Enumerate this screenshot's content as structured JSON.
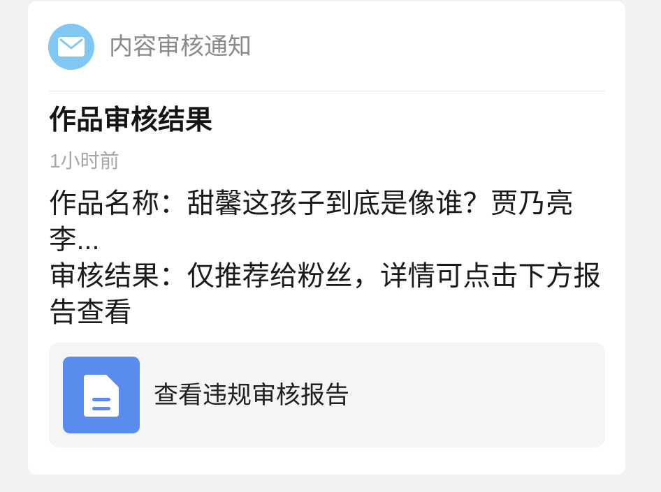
{
  "header": {
    "icon": "envelope-icon",
    "title": "内容审核通知"
  },
  "notification": {
    "title": "作品审核结果",
    "time": "1小时前",
    "work_name_label": "作品名称：",
    "work_name_value": "甜馨这孩子到底是像谁？贾乃亮李...",
    "result_label": "审核结果：",
    "result_value": "仅推荐给粉丝，详情可点击下方报告查看"
  },
  "report_link": {
    "icon": "document-icon",
    "label": "查看违规审核报告"
  },
  "colors": {
    "page_background": "#f1f2f4",
    "card_background": "#ffffff",
    "envelope_circle": "#81c7f4",
    "report_icon_background": "#5a8cf0",
    "report_box_background": "#f4f5f7"
  }
}
